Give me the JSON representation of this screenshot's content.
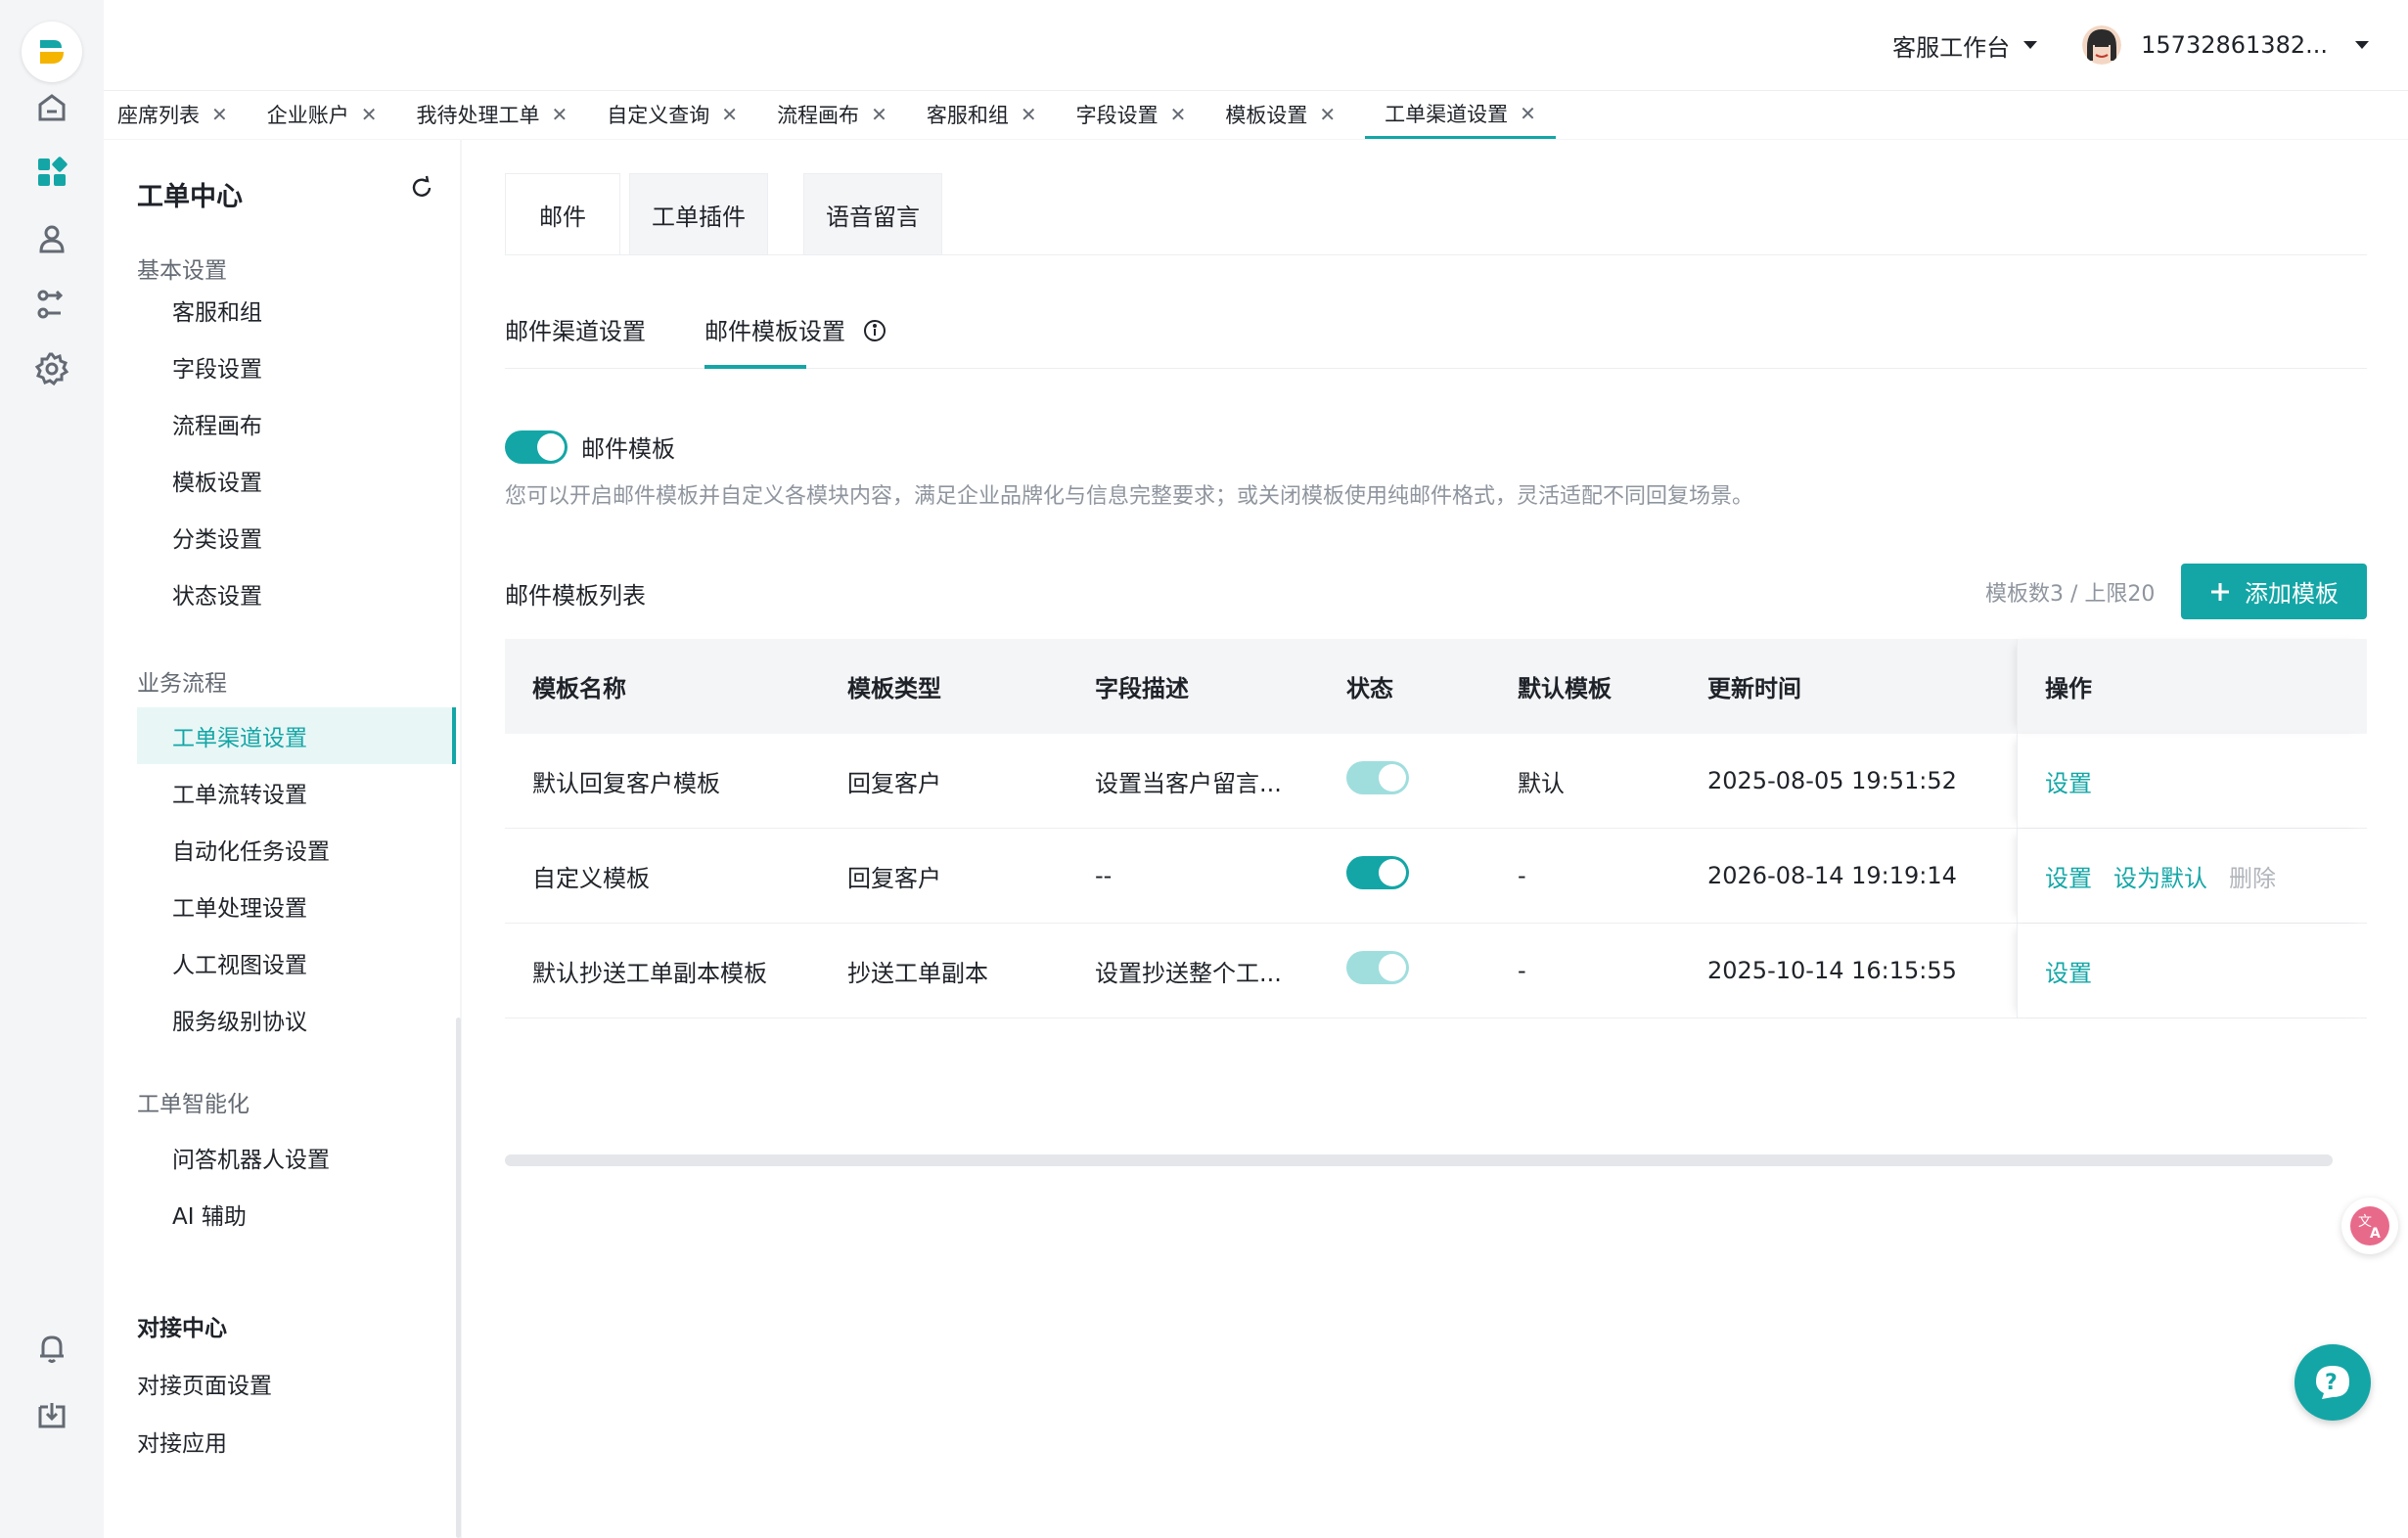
{
  "topbar": {
    "workspace": "客服工作台",
    "username": "15732861382..."
  },
  "page_tabs": [
    {
      "label": "座席列表"
    },
    {
      "label": "企业账户"
    },
    {
      "label": "我待处理工单"
    },
    {
      "label": "自定义查询"
    },
    {
      "label": "流程画布"
    },
    {
      "label": "客服和组"
    },
    {
      "label": "字段设置"
    },
    {
      "label": "模板设置"
    },
    {
      "label": "工单渠道设置"
    }
  ],
  "sidebar": {
    "title": "工单中心",
    "groups": [
      {
        "label": "基本设置",
        "items": [
          "客服和组",
          "字段设置",
          "流程画布",
          "模板设置",
          "分类设置",
          "状态设置"
        ]
      },
      {
        "label": "业务流程",
        "items": [
          "工单渠道设置",
          "工单流转设置",
          "自动化任务设置",
          "工单处理设置",
          "人工视图设置",
          "服务级别协议"
        ]
      },
      {
        "label": "工单智能化",
        "items": [
          "问答机器人设置",
          "AI 辅助"
        ]
      }
    ],
    "section2_title": "对接中心",
    "section2_items": [
      "对接页面设置",
      "对接应用"
    ]
  },
  "content_tabs": [
    "邮件",
    "工单插件",
    "语音留言"
  ],
  "sub_tabs": [
    "邮件渠道设置",
    "邮件模板设置"
  ],
  "toggle_label": "邮件模板",
  "description": "您可以开启邮件模板并自定义各模块内容，满足企业品牌化与信息完整要求；或关闭模板使用纯邮件格式，灵活适配不同回复场景。",
  "list": {
    "title": "邮件模板列表",
    "quota": "模板数3 / 上限20",
    "add_button": "添加模板"
  },
  "table": {
    "headers": [
      "模板名称",
      "模板类型",
      "字段描述",
      "状态",
      "默认模板",
      "更新时间",
      "操作"
    ],
    "rows": [
      {
        "name": "默认回复客户模板",
        "type": "回复客户",
        "desc": "设置当客户留言...",
        "status_on": true,
        "status_disabled": true,
        "default": "默认",
        "updated": "2025-08-05 19:51:52",
        "actions": [
          "设置"
        ]
      },
      {
        "name": "自定义模板",
        "type": "回复客户",
        "desc": "--",
        "status_on": true,
        "status_disabled": false,
        "default": "-",
        "updated": "2026-08-14 19:19:14",
        "actions": [
          "设置",
          "设为默认",
          "删除"
        ]
      },
      {
        "name": "默认抄送工单副本模板",
        "type": "抄送工单副本",
        "desc": "设置抄送整个工...",
        "status_on": true,
        "status_disabled": true,
        "default": "-",
        "updated": "2025-10-14 16:15:55",
        "actions": [
          "设置"
        ]
      }
    ]
  },
  "colors": {
    "accent": "#14a6a6",
    "accent_light": "#a0dede",
    "bg": "#f4f5f7"
  }
}
